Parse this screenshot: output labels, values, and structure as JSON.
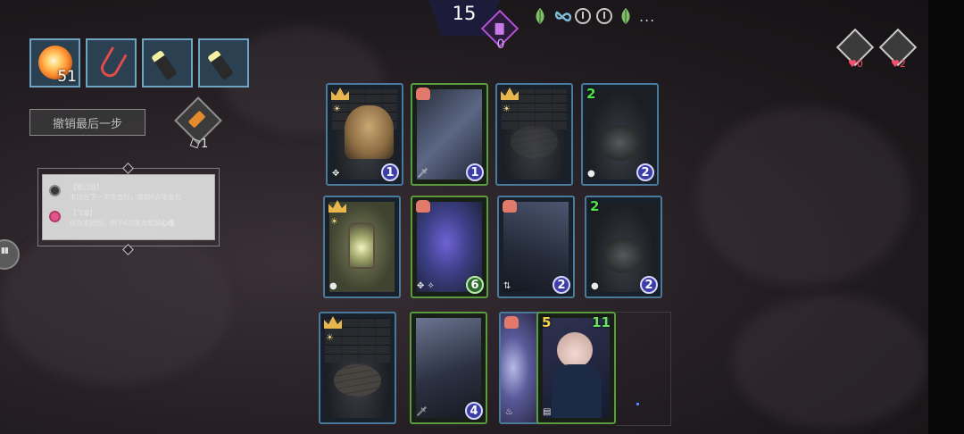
{
  "top_bar": {
    "turn": "15",
    "deck_count": "0",
    "statuses": [
      "leaf-icon",
      "infinity-knot-icon",
      "timer-icon",
      "timer-icon",
      "leaf-icon"
    ],
    "more": "..."
  },
  "items": [
    {
      "icon": "fire-orb-icon",
      "count": "51"
    },
    {
      "icon": "hook-icon",
      "count": ""
    },
    {
      "icon": "flashlight-icon",
      "count": ""
    },
    {
      "icon": "flashlight-icon",
      "count": ""
    }
  ],
  "undo_button": {
    "label": "撤销最后一步"
  },
  "relic": {
    "icon": "torch-icon",
    "count": "1"
  },
  "tooltip": {
    "entries": [
      {
        "title": "【磨刀油】",
        "desc": "本回合下一次攻击时，增加4点攻击力"
      },
      {
        "title": "【飞雪】",
        "desc_prefix": "仅在本回合，你下4次攻击附加",
        "desc_bold": "心魂"
      }
    ]
  },
  "right_top": {
    "left_count": "0",
    "right_count": "2"
  },
  "cards": [
    {
      "name": "haystack",
      "badge": "crown",
      "cost": "1",
      "frame": "blue"
    },
    {
      "name": "wind-slash",
      "badge": "fist",
      "cost": "1",
      "frame": "green"
    },
    {
      "name": "dark-room",
      "badge": "crown",
      "cost": "",
      "frame": "blue"
    },
    {
      "name": "pit-room",
      "badge_num": "2",
      "cost": "2",
      "frame": "blue"
    },
    {
      "name": "lantern",
      "badge": "crown",
      "cost": "",
      "frame": "blue"
    },
    {
      "name": "purple-strike",
      "badge": "fist",
      "cost": "6",
      "frame": "green"
    },
    {
      "name": "lightning",
      "badge": "fist",
      "cost": "2",
      "frame": "blue"
    },
    {
      "name": "pit-room-2",
      "badge_num": "2",
      "cost": "2",
      "frame": "blue"
    },
    {
      "name": "floor-room",
      "badge": "crown",
      "cost": "",
      "frame": "blue"
    },
    {
      "name": "shard",
      "badge": "",
      "cost": "4",
      "frame": "green"
    },
    {
      "name": "swirl",
      "badge": "fist",
      "cost": "",
      "frame": "blue"
    },
    {
      "name": "girl",
      "attack": "5",
      "hp": "11",
      "frame": "green"
    }
  ]
}
